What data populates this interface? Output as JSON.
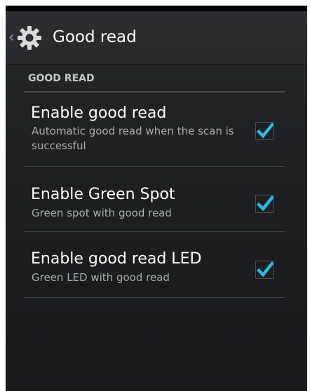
{
  "action_bar": {
    "title": "Good read",
    "back_icon": "chevron-left-icon",
    "app_icon": "gear-icon"
  },
  "section": {
    "header": "GOOD READ"
  },
  "items": [
    {
      "title": "Enable good read",
      "subtitle": "Automatic good read when the scan is successful",
      "checked": true
    },
    {
      "title": "Enable Green Spot",
      "subtitle": "Green spot with good read",
      "checked": true
    },
    {
      "title": "Enable good read LED",
      "subtitle": "Green LED with good read",
      "checked": true
    }
  ],
  "colors": {
    "accent": "#33b5e5",
    "background": "#1e2124",
    "text_primary": "#ffffff",
    "text_secondary": "#a9adb2"
  }
}
